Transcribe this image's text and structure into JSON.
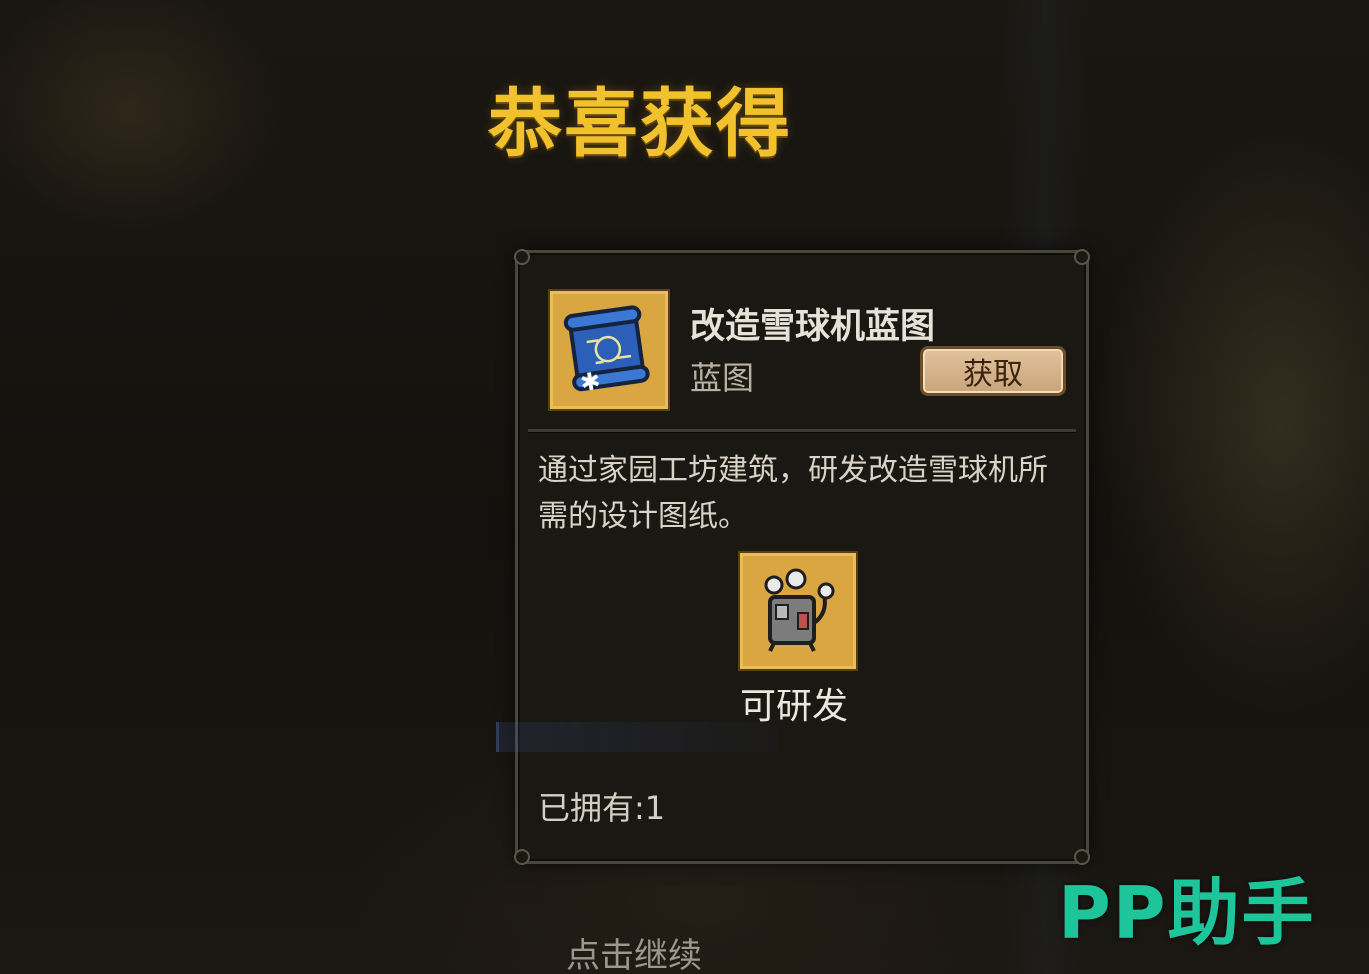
{
  "header": {
    "title": "恭喜获得"
  },
  "item": {
    "name": "改造雪球机蓝图",
    "type": "蓝图",
    "icon": "blueprint-scroll-icon",
    "get_button_label": "获取",
    "description": "通过家园工坊建筑，研发改造雪球机所需的设计图纸。",
    "unlock_icon": "snowball-machine-icon",
    "unlock_label": "可研发",
    "owned_text": "已拥有:1"
  },
  "footer": {
    "tap_to_continue": "点击继续"
  },
  "watermark": {
    "text": "PP助手"
  },
  "colors": {
    "title_gold": "#f2c12e",
    "icon_frame": "#d9a642",
    "button_bg": "#d9b68c",
    "watermark_green": "#1fc59a"
  }
}
